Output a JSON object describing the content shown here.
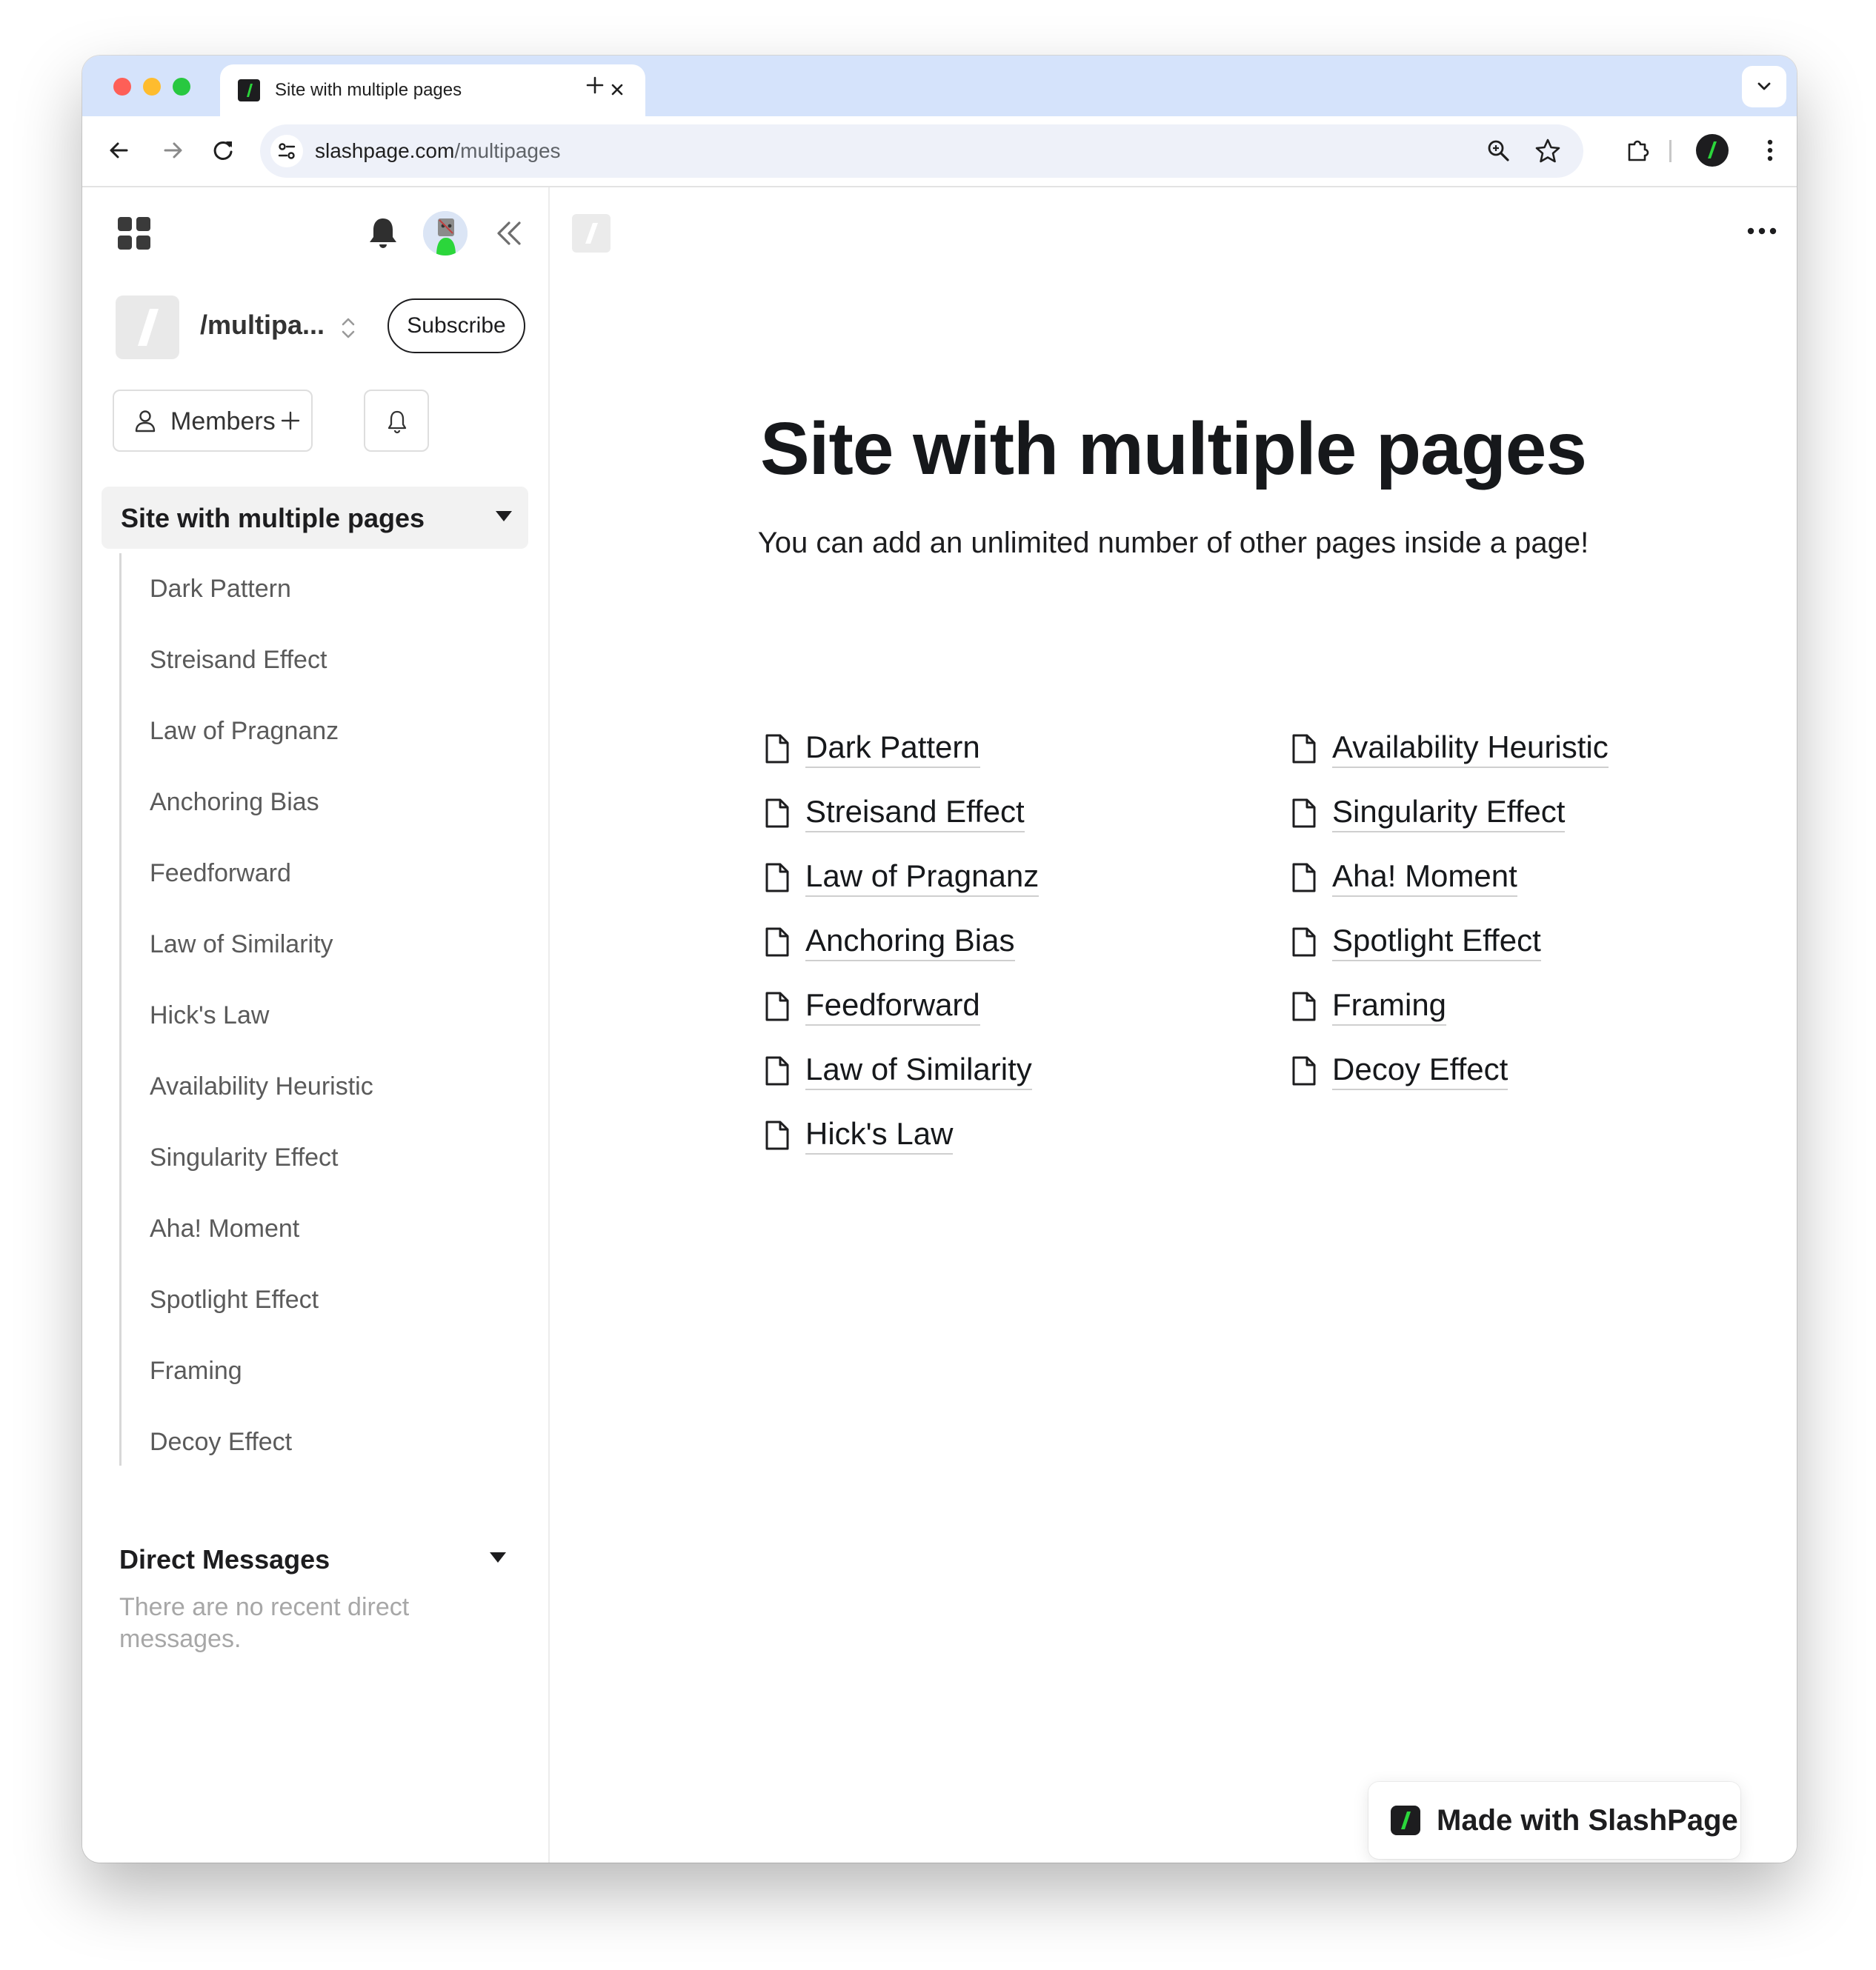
{
  "browser": {
    "tab_title": "Site with multiple pages",
    "url_host": "slashpage.com",
    "url_path": "/multipages"
  },
  "sidebar": {
    "site_name": "/multipa...",
    "subscribe_label": "Subscribe",
    "members_label": "Members",
    "section_title": "Site with multiple pages",
    "pages": [
      "Dark Pattern",
      "Streisand Effect",
      "Law of Pragnanz",
      "Anchoring Bias",
      "Feedforward",
      "Law of Similarity",
      "Hick's Law",
      "Availability Heuristic",
      "Singularity Effect",
      "Aha! Moment",
      "Spotlight Effect",
      "Framing",
      "Decoy Effect"
    ],
    "dm_title": "Direct Messages",
    "dm_empty": "There are no recent direct messages."
  },
  "main": {
    "title": "Site with multiple pages",
    "subtitle": "You can add an unlimited number of other pages inside a page!",
    "links": [
      "Dark Pattern",
      "Streisand Effect",
      "Law of Pragnanz",
      "Anchoring Bias",
      "Feedforward",
      "Law of Similarity",
      "Hick's Law",
      "Availability Heuristic",
      "Singularity Effect",
      "Aha! Moment",
      "Spotlight Effect",
      "Framing",
      "Decoy Effect"
    ],
    "badge": "Made with SlashPage"
  },
  "colors": {
    "accent_green": "#2bd63b",
    "tabstrip": "#d5e3fb",
    "text_dark": "#16181b"
  }
}
